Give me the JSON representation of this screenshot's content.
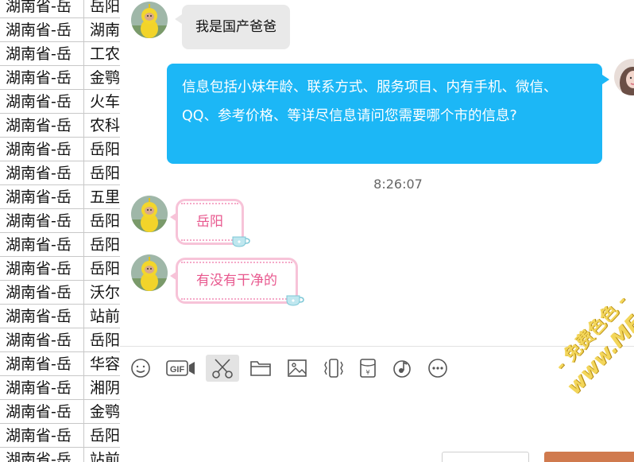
{
  "spreadsheet": {
    "rows": [
      {
        "a": "湖南省-岳",
        "b": "岳阳"
      },
      {
        "a": "湖南省-岳",
        "b": "湖南"
      },
      {
        "a": "湖南省-岳",
        "b": "工农"
      },
      {
        "a": "湖南省-岳",
        "b": "金鹗"
      },
      {
        "a": "湖南省-岳",
        "b": "火车"
      },
      {
        "a": "湖南省-岳",
        "b": "农科"
      },
      {
        "a": "湖南省-岳",
        "b": "岳阳"
      },
      {
        "a": "湖南省-岳",
        "b": "岳阳"
      },
      {
        "a": "湖南省-岳",
        "b": "五里"
      },
      {
        "a": "湖南省-岳",
        "b": "岳阳"
      },
      {
        "a": "湖南省-岳",
        "b": "岳阳"
      },
      {
        "a": "湖南省-岳",
        "b": "岳阳"
      },
      {
        "a": "湖南省-岳",
        "b": "沃尔"
      },
      {
        "a": "湖南省-岳",
        "b": "站前"
      },
      {
        "a": "湖南省-岳",
        "b": "岳阳"
      },
      {
        "a": "湖南省-岳",
        "b": "华容"
      },
      {
        "a": "湖南省-岳",
        "b": "湘阴"
      },
      {
        "a": "湖南省-岳",
        "b": "金鹗"
      },
      {
        "a": "湖南省-岳",
        "b": "岳阳"
      },
      {
        "a": "湖南省-岳",
        "b": "站前"
      }
    ]
  },
  "chat": {
    "messages": [
      {
        "text": "我是国产爸爸"
      },
      {
        "text": "信息包括小妹年龄、联系方式、服务项目、内有手机、微信、QQ、参考价格、等详尽信息请问您需要哪个市的信息?"
      },
      {
        "text": "岳阳"
      },
      {
        "text": "有没有干净的"
      }
    ],
    "timestamp": "8:26:07"
  },
  "toolbar": {
    "icons": [
      "emoji-icon",
      "gif-icon",
      "scissors-icon",
      "folder-icon",
      "image-icon",
      "shake-icon",
      "red-packet-icon",
      "music-icon",
      "more-icon"
    ],
    "gif_label": "GIF"
  },
  "watermark": {
    "line1": "- 免费色色 -",
    "line2": "www.MFsese.com"
  },
  "colors": {
    "blue_bubble": "#1cb7f6",
    "gray_bubble": "#e9e9e9",
    "pink_text": "#e8588e",
    "pink_border": "#f7c3d8",
    "send_button": "#d07a4e"
  }
}
